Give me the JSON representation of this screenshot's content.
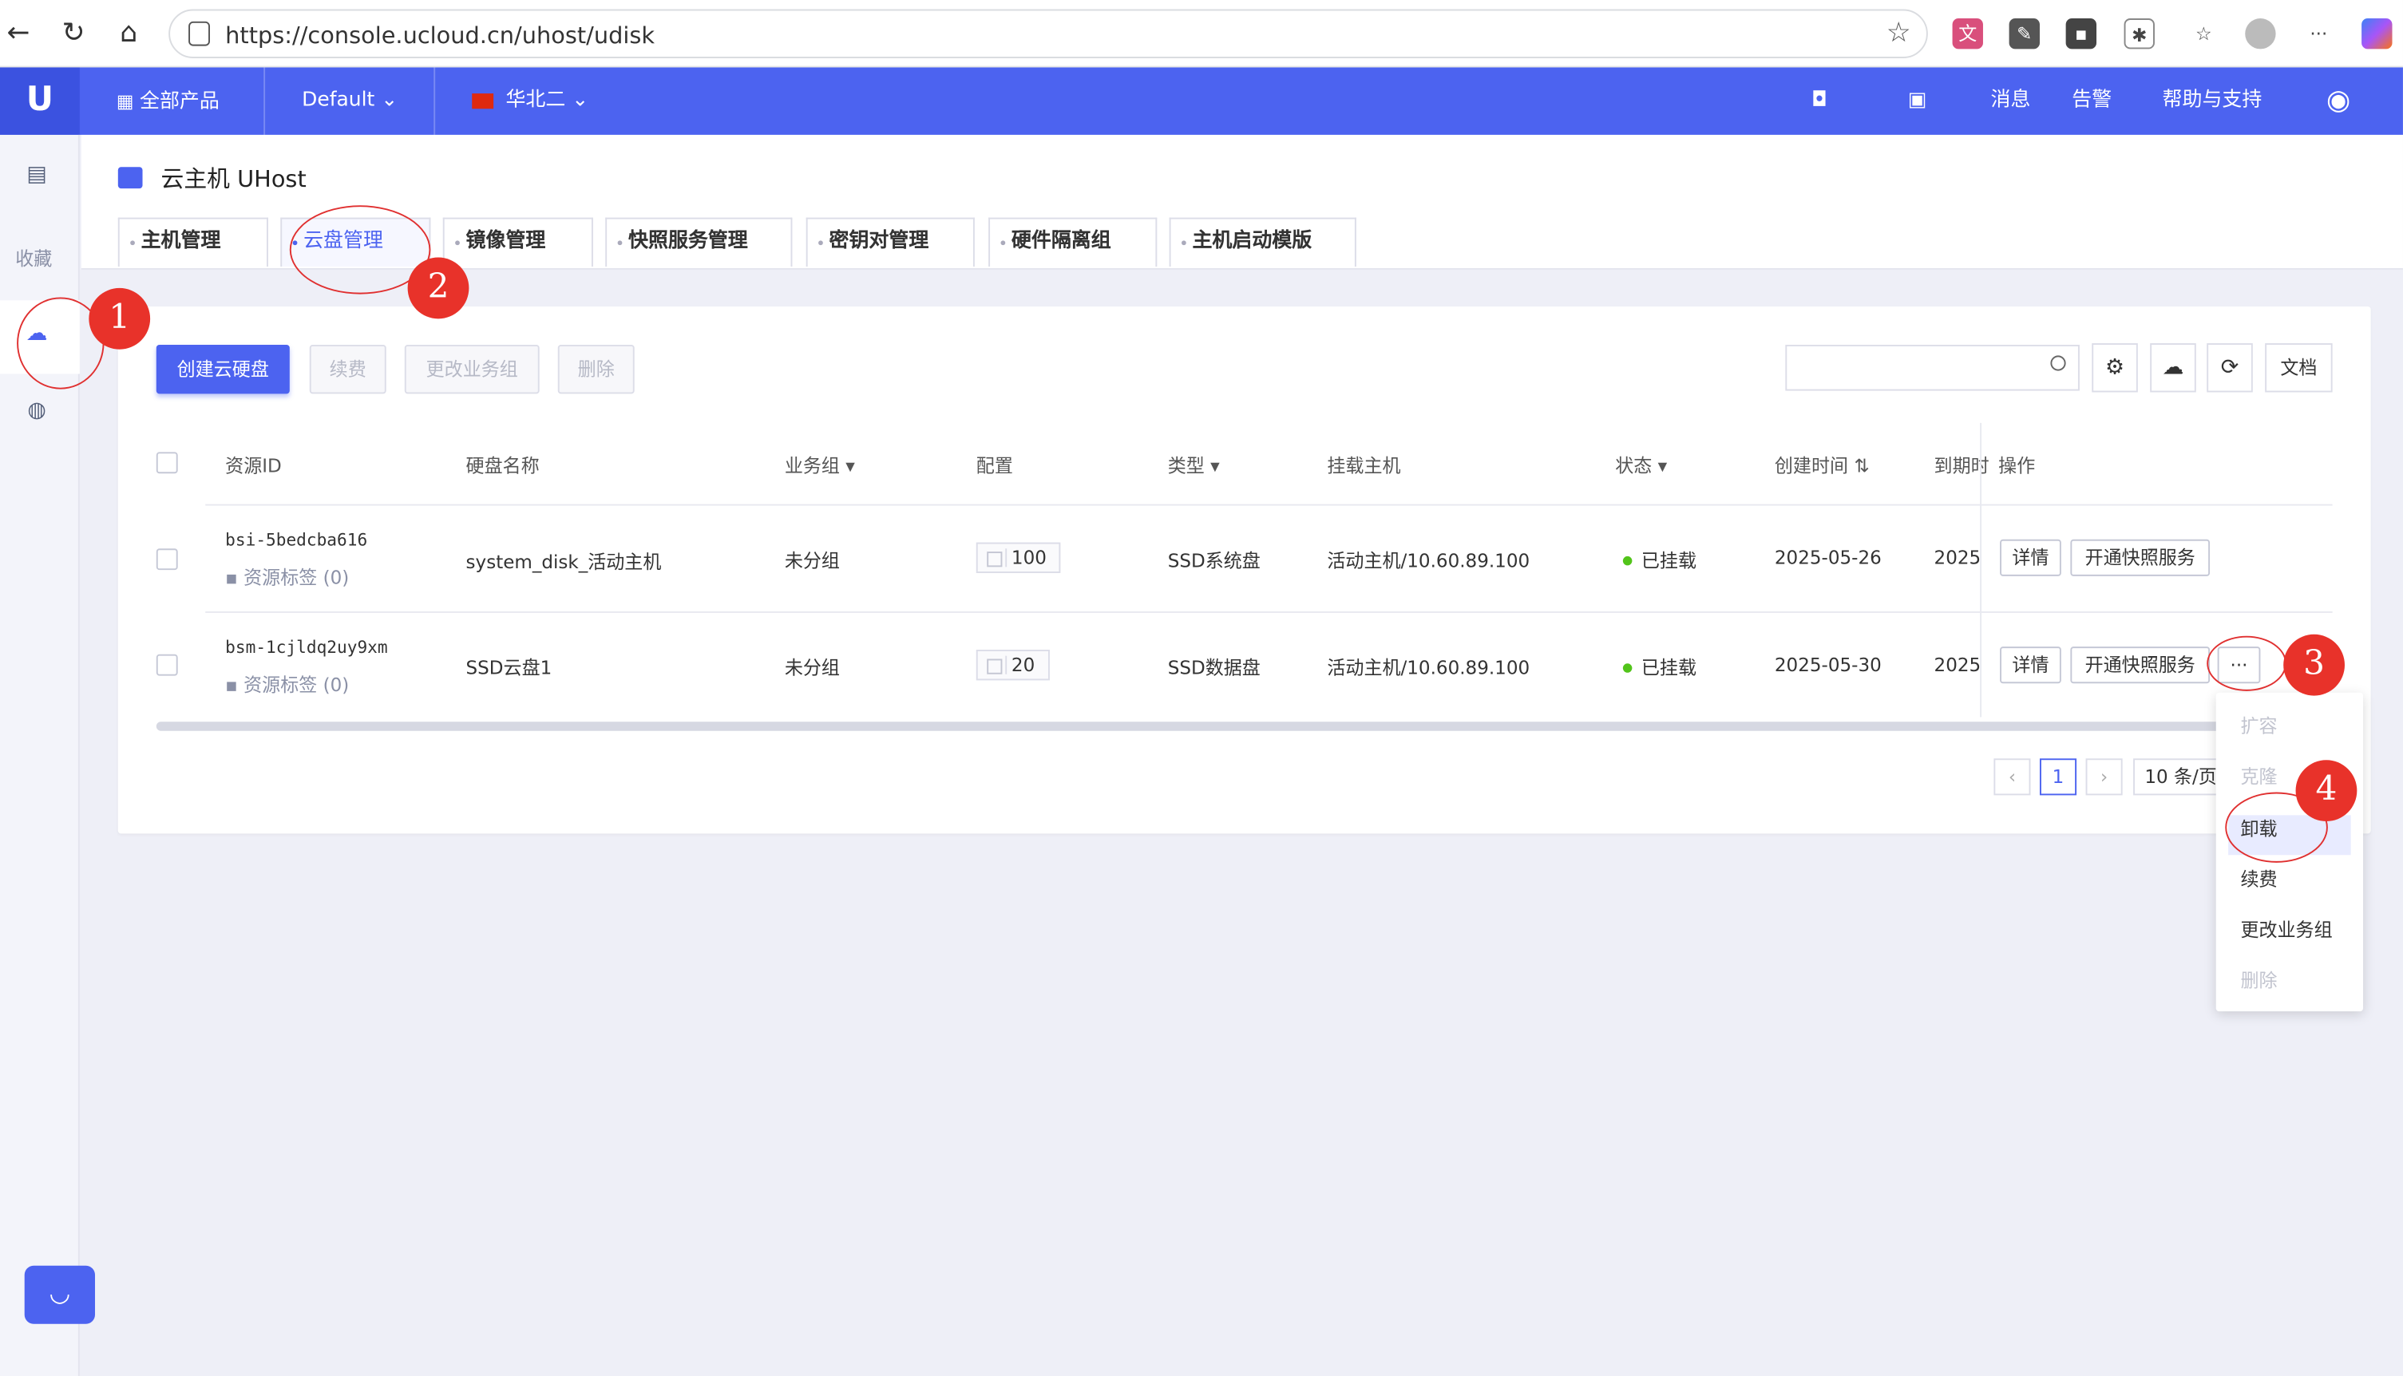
{
  "browser": {
    "url": "https://console.ucloud.cn/uhost/udisk"
  },
  "header": {
    "logo": "U",
    "all_products": "全部产品",
    "project": "Default",
    "region": "华北二",
    "messages": "消息",
    "alerts": "告警",
    "help": "帮助与支持"
  },
  "sidebar": {
    "favorites_label": "收藏"
  },
  "page": {
    "title": "云主机 UHost",
    "tabs": [
      "主机管理",
      "云盘管理",
      "镜像管理",
      "快照服务管理",
      "密钥对管理",
      "硬件隔离组",
      "主机启动模版"
    ]
  },
  "toolbar": {
    "create": "创建云硬盘",
    "renew": "续费",
    "change_group": "更改业务组",
    "delete": "删除",
    "docs": "文档"
  },
  "table": {
    "headers": [
      "资源ID",
      "硬盘名称",
      "业务组",
      "配置",
      "类型",
      "挂载主机",
      "状态",
      "创建时间",
      "到期时",
      "操作"
    ],
    "rows": [
      {
        "id": "bsi-5bedcba616",
        "tag": "资源标签 (0)",
        "name": "system_disk_活动主机",
        "group": "未分组",
        "config": "100",
        "type": "SSD系统盘",
        "host": "活动主机/10.60.89.100",
        "status": "已挂载",
        "created": "2025-05-26",
        "expire": "2025-",
        "op_detail": "详情",
        "op_snapshot": "开通快照服务"
      },
      {
        "id": "bsm-1cjldq2uy9xm",
        "tag": "资源标签 (0)",
        "name": "SSD云盘1",
        "group": "未分组",
        "config": "20",
        "type": "SSD数据盘",
        "host": "活动主机/10.60.89.100",
        "status": "已挂载",
        "created": "2025-05-30",
        "expire": "2025-",
        "op_detail": "详情",
        "op_snapshot": "开通快照服务",
        "op_more": "···"
      }
    ]
  },
  "pagination": {
    "prev": "‹",
    "current": "1",
    "next": "›",
    "size": "10 条/页"
  },
  "dropdown": {
    "items": [
      "扩容",
      "克隆",
      "卸载",
      "续费",
      "更改业务组",
      "删除"
    ]
  },
  "annotations": [
    "1",
    "2",
    "3",
    "4"
  ]
}
